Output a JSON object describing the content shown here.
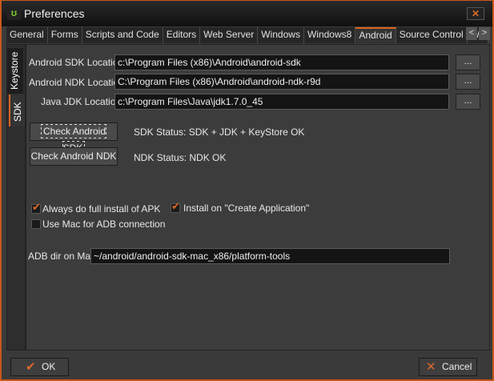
{
  "window": {
    "title": "Preferences",
    "close": "✕"
  },
  "tabs": [
    "General",
    "Forms",
    "Scripts and Code",
    "Editors",
    "Web Server",
    "Windows",
    "Windows8",
    "Android",
    "Source Control",
    "Wind"
  ],
  "active_tab": "Android",
  "tab_scroll": {
    "left": "<",
    "right": ">"
  },
  "side_tabs": [
    "Keystore",
    "SDK"
  ],
  "active_side_tab": "SDK",
  "fields": {
    "sdk": {
      "label": "Android SDK Location",
      "value": "c:\\Program Files (x86)\\Android\\android-sdk",
      "browse": "..."
    },
    "ndk": {
      "label": "Android NDK Location",
      "value": "C:\\Program Files (x86)\\Android\\android-ndk-r9d",
      "browse": "..."
    },
    "jdk": {
      "label": "Java JDK Location",
      "value": "c:\\Program Files\\Java\\jdk1.7.0_45",
      "browse": "..."
    }
  },
  "checks": {
    "sdk": {
      "button": "Check Android SDK",
      "status": "SDK Status:  SDK + JDK + KeyStore OK"
    },
    "ndk": {
      "button": "Check Android NDK",
      "status": "NDK Status: NDK OK"
    }
  },
  "options": [
    {
      "label": "Always do full install of APK",
      "checked": true
    },
    {
      "label": "Install on \"Create Application\"",
      "checked": true
    },
    {
      "label": "Use Mac for ADB connection",
      "checked": false
    }
  ],
  "adb": {
    "label": "ADB dir on Mac",
    "value": "~/android/android-sdk-mac_x86/platform-tools"
  },
  "footer": {
    "ok": "OK",
    "cancel": "Cancel"
  },
  "colors": {
    "accent": "#d8641e"
  }
}
